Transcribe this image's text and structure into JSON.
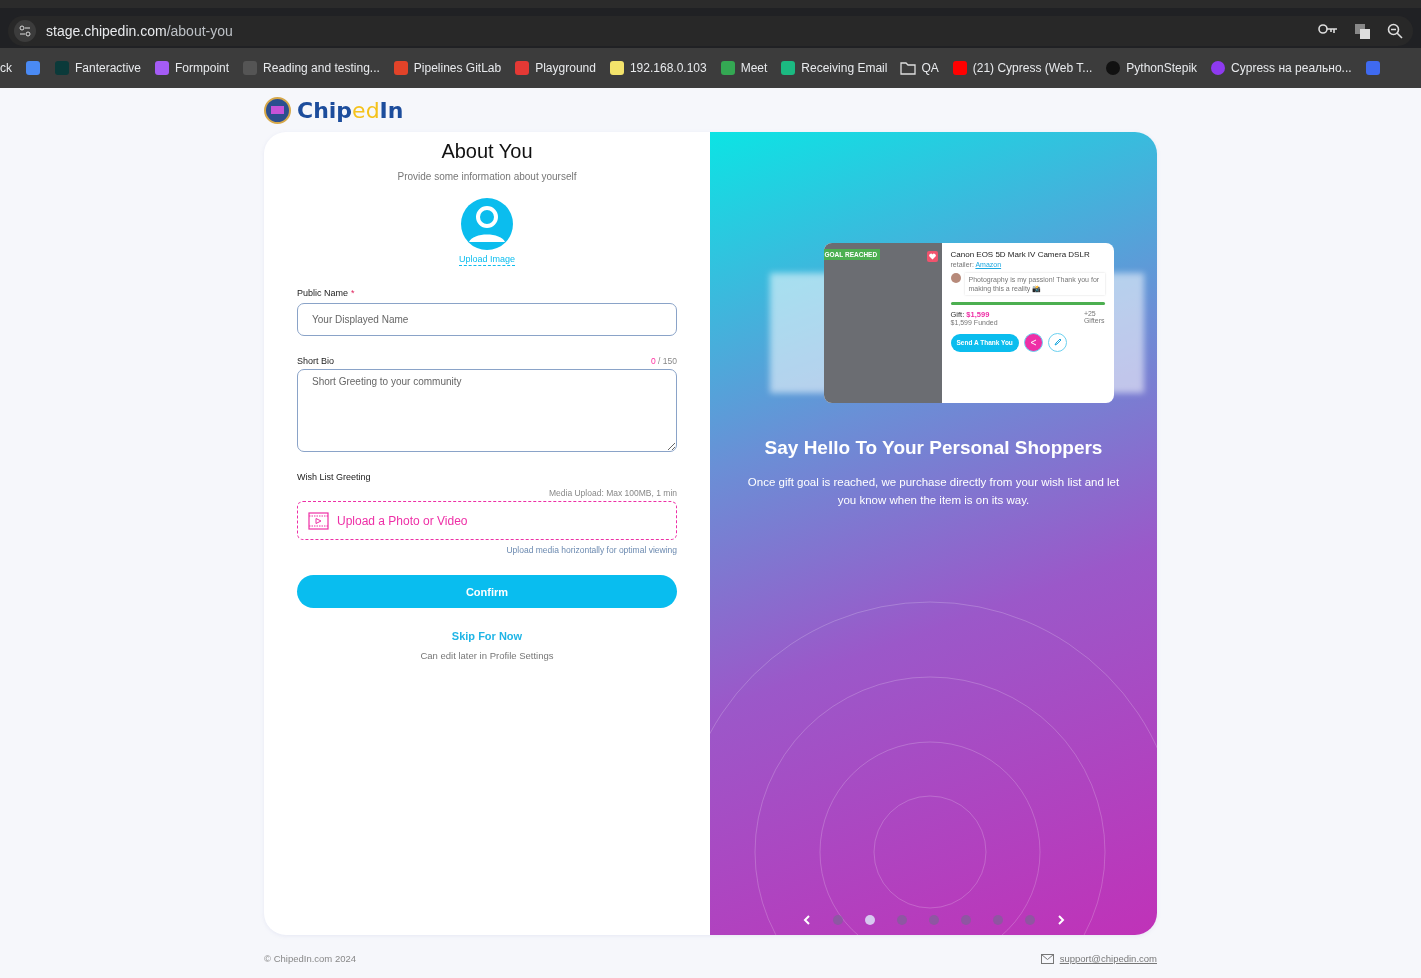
{
  "browser": {
    "url_host": "stage.chipedin.com",
    "url_path": "/about-you",
    "bookmarks": [
      {
        "label": "ck",
        "kind": "none"
      },
      {
        "kind": "translate"
      },
      {
        "label": "Fanteractive",
        "kind": "star"
      },
      {
        "label": "Formpoint",
        "kind": "v"
      },
      {
        "label": "Reading and testing...",
        "kind": "person"
      },
      {
        "label": "Pipelines GitLab",
        "kind": "fox"
      },
      {
        "label": "Playground",
        "kind": "flame"
      },
      {
        "label": "192.168.0.103",
        "kind": "grid"
      },
      {
        "label": "Meet",
        "kind": "camera"
      },
      {
        "label": "Receiving Email",
        "kind": "m"
      },
      {
        "label": "QA",
        "kind": "folder"
      },
      {
        "label": "(21) Cypress (Web T...",
        "kind": "play"
      },
      {
        "label": "PythonStepik",
        "kind": "s"
      },
      {
        "label": "Cypress на реально...",
        "kind": "u"
      },
      {
        "kind": "copilot"
      }
    ]
  },
  "logo": {
    "prefix": "Chip",
    "accent": "ed",
    "suffix": "In"
  },
  "form": {
    "title": "About You",
    "subtitle": "Provide some information about yourself",
    "upload_image": "Upload Image",
    "public_name": {
      "label": "Public Name",
      "required_mark": "*",
      "placeholder": "Your Displayed Name"
    },
    "short_bio": {
      "label": "Short Bio",
      "count": "0",
      "max": "/ 150",
      "placeholder": "Short Greeting to your community"
    },
    "wish_list": {
      "label": "Wish List Greeting",
      "limit": "Media Upload: Max 100MB, 1 min",
      "upload": "Upload a Photo or Video",
      "hint": "Upload media horizontally for optimal viewing"
    },
    "confirm": "Confirm",
    "skip": "Skip For Now",
    "skip_note": "Can edit later in Profile Settings"
  },
  "promo": {
    "card": {
      "badge": "GOAL REACHED",
      "title": "Canon EOS 5D Mark IV Camera DSLR",
      "retailer_label": "retailer:",
      "retailer": "Amazon",
      "message": "Photography is my passion! Thank you for making this a reality 📸",
      "level": 1,
      "gift_label": "Gift:",
      "gift_amount": "$1,599",
      "funded": "$1,599 Funded",
      "gifters_count": "+25",
      "gifters_label": "Gifters",
      "thank_button": "Send A Thank You"
    },
    "heading": "Say Hello To Your Personal Shoppers",
    "text": "Once gift goal is reached, we purchase directly from your wish list and let you know when the item is on its way.",
    "dots": [
      {
        "selected": false
      },
      {
        "selected": true
      },
      {
        "selected": false
      },
      {
        "selected": false
      },
      {
        "selected": false
      },
      {
        "selected": false
      },
      {
        "selected": false
      }
    ]
  },
  "footer": {
    "copyright": "© ChipedIn.com 2024",
    "email": "support@chipedin.com"
  }
}
